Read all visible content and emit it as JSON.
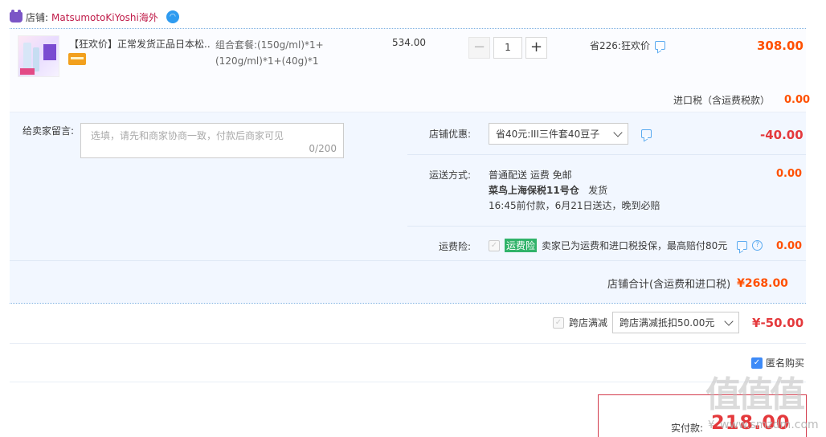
{
  "shop": {
    "label": "店铺:",
    "name": "MatsumotoKiYoshi海外"
  },
  "item": {
    "title": "【狂欢价】正常发货正品日本松...",
    "sku": "组合套餐:(150g/ml)*1+(120g/ml)*1+(40g)*1",
    "unit_price": "534.00",
    "quantity": "1",
    "qty_minus": "−",
    "qty_plus": "+",
    "promo": "省226:狂欢价",
    "total": "308.00"
  },
  "tax": {
    "label": "进口税（含运费税款）",
    "value": "0.00"
  },
  "message": {
    "label": "给卖家留言:",
    "placeholder": "选填，请先和商家协商一致，付款后商家可见",
    "count": "0/200"
  },
  "coupon": {
    "label": "店铺优惠:",
    "selected": "省40元:III三件套40豆子",
    "value": "-40.00"
  },
  "shipping": {
    "label": "运送方式:",
    "line1": "普通配送 运费 免邮",
    "line2_bold": "菜鸟上海保税11号仓",
    "line2_rest": "发货",
    "line3": "16:45前付款，6月21日送达，晚到必赔",
    "value": "0.00"
  },
  "insurance": {
    "label": "运费险:",
    "badge": "运费险",
    "text": "卖家已为运费和进口税投保，最高赔付80元",
    "value": "0.00"
  },
  "shop_total": {
    "label": "店铺合计(含运费和进口税)",
    "value": "¥268.00"
  },
  "cross_store": {
    "label": "跨店满减",
    "selected": "跨店满减抵扣50.00元",
    "value": "¥-50.00"
  },
  "anonymous": {
    "label": "匿名购买",
    "checked": true
  },
  "payment": {
    "label": "实付款:",
    "currency": "¥",
    "amount": "218.00"
  },
  "watermark": {
    "logo": "值值值",
    "url": "www.smzdm.com"
  },
  "colors": {
    "accent_orange": "#ff5000",
    "accent_red": "#e4393c",
    "shop_name": "#c01d4a",
    "panel_bg": "#f2f7ff",
    "ins_badge": "#31b36a"
  }
}
